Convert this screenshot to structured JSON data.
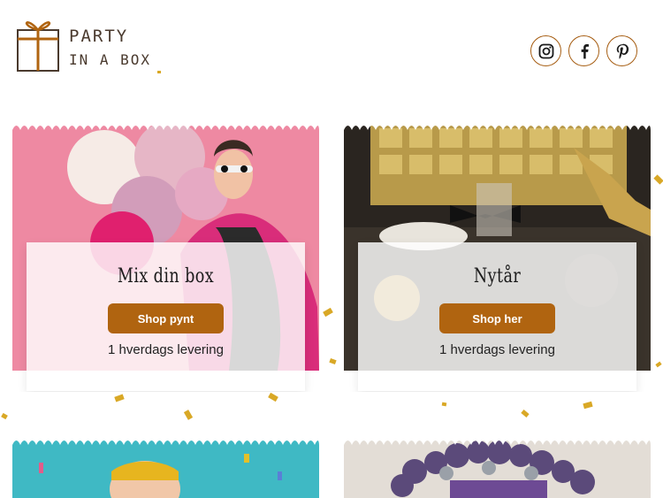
{
  "header": {
    "logo_line1": "PARTY",
    "logo_line2": "IN A BOX",
    "social": [
      {
        "name": "instagram-icon"
      },
      {
        "name": "facebook-icon"
      },
      {
        "name": "pinterest-icon"
      }
    ]
  },
  "colors": {
    "accent": "#b06410",
    "social_border": "#a65d12",
    "confetti": "#d9a826"
  },
  "cards": [
    {
      "title": "Mix din box",
      "button": "Shop pynt",
      "delivery": "1 hverdags levering"
    },
    {
      "title": "Nytår",
      "button": "Shop her",
      "delivery": "1 hverdags levering"
    }
  ]
}
